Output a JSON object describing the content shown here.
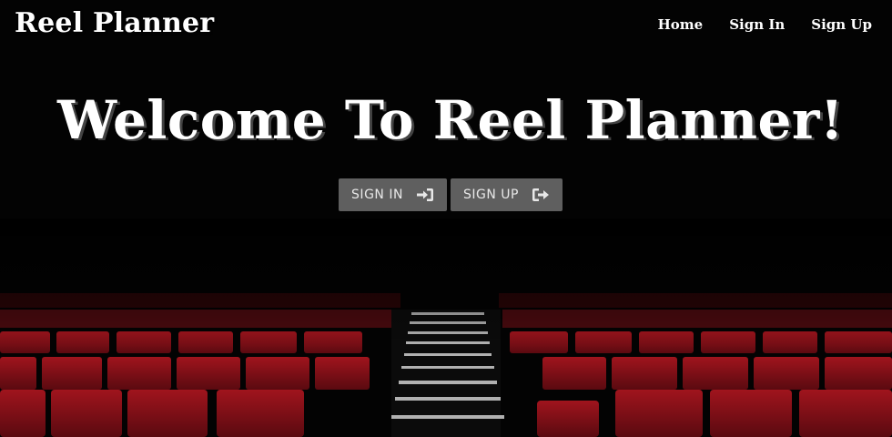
{
  "navbar": {
    "brand": "Reel Planner",
    "links": [
      "Home",
      "Sign In",
      "Sign Up"
    ]
  },
  "hero": {
    "title": "Welcome To Reel Planner!",
    "buttons": [
      {
        "label": "SIGN IN",
        "icon": "sign-in-icon"
      },
      {
        "label": "SIGN UP",
        "icon": "sign-out-icon"
      }
    ]
  },
  "colors": {
    "background": "#000000",
    "button": "#5f5f5f",
    "seat_red": "#8b0f18",
    "text": "#ffffff"
  }
}
